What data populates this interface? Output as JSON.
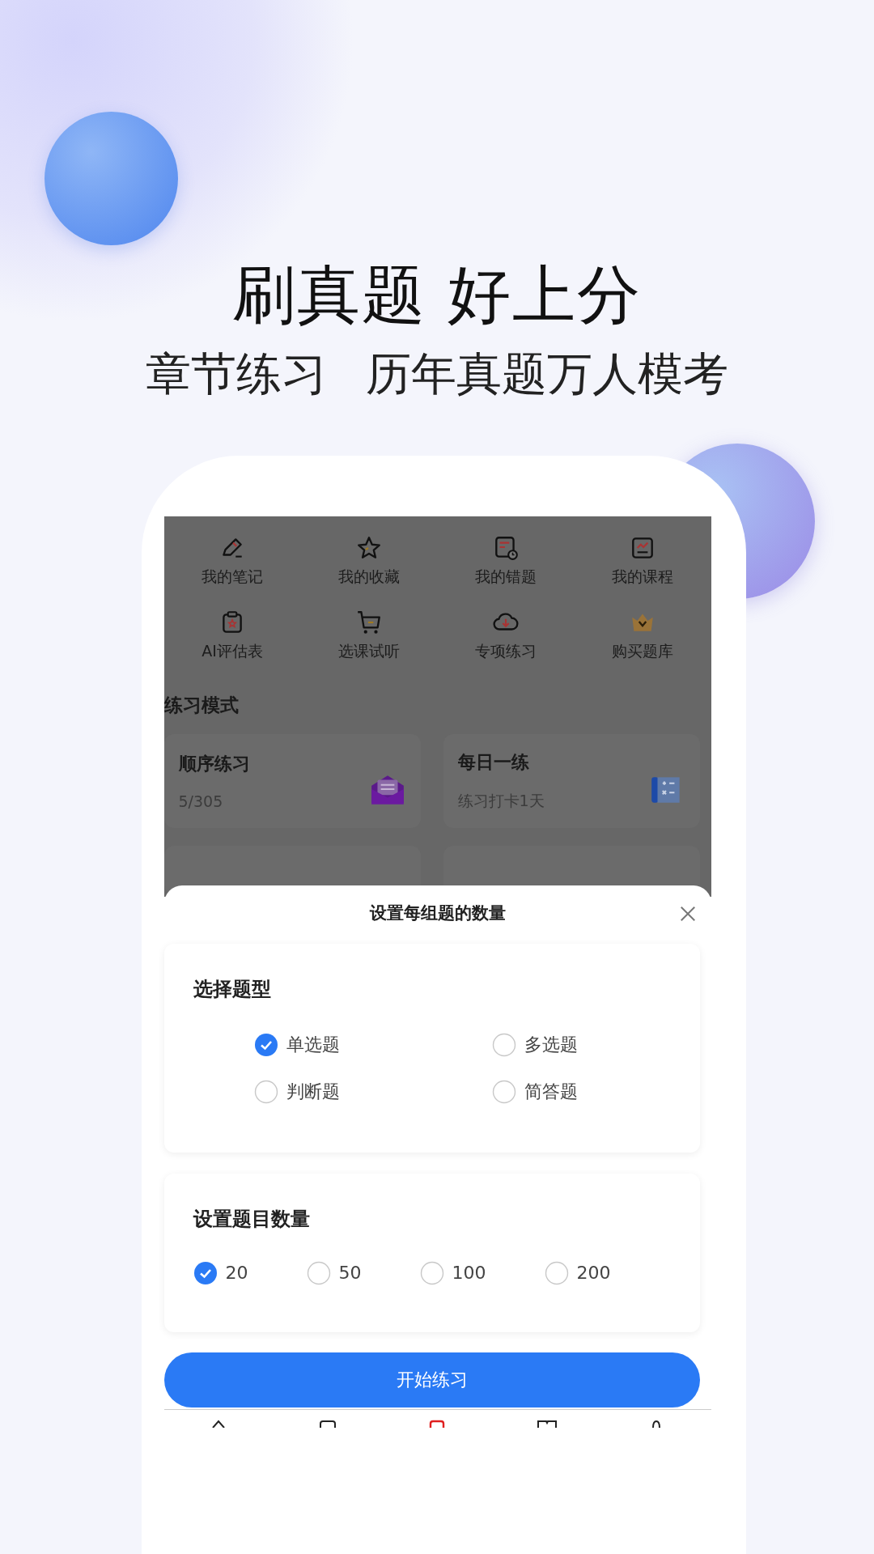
{
  "headline": "刷真题 好上分",
  "subheadlines": [
    "章节练习",
    "历年真题万人模考"
  ],
  "shortcuts": [
    {
      "label": "我的笔记"
    },
    {
      "label": "我的收藏"
    },
    {
      "label": "我的错题"
    },
    {
      "label": "我的课程"
    },
    {
      "label": "AI评估表"
    },
    {
      "label": "选课试听"
    },
    {
      "label": "专项练习"
    },
    {
      "label": "购买题库"
    }
  ],
  "section_title": "练习模式",
  "mode_cards": [
    {
      "title": "顺序练习",
      "subtitle": "5/305"
    },
    {
      "title": "每日一练",
      "subtitle": "练习打卡1天"
    }
  ],
  "sheet": {
    "title": "设置每组题的数量",
    "type_group": {
      "title": "选择题型",
      "options": [
        {
          "label": "单选题",
          "selected": true
        },
        {
          "label": "多选题",
          "selected": false
        },
        {
          "label": "判断题",
          "selected": false
        },
        {
          "label": "简答题",
          "selected": false
        }
      ]
    },
    "count_group": {
      "title": "设置题目数量",
      "options": [
        {
          "label": "20",
          "selected": true
        },
        {
          "label": "50",
          "selected": false
        },
        {
          "label": "100",
          "selected": false
        },
        {
          "label": "200",
          "selected": false
        }
      ]
    },
    "start_button": "开始练习"
  }
}
